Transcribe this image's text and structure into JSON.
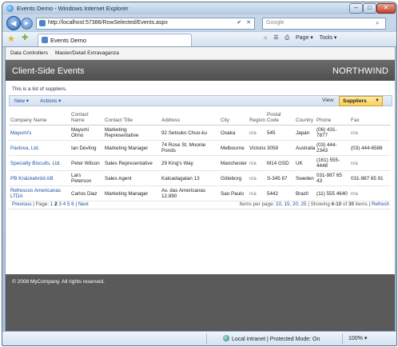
{
  "window": {
    "title": "Events Demo - Windows Internet Explorer"
  },
  "address_bar": {
    "url": "http://localhost:57386/RowSelected/Events.aspx",
    "buttons": "✔ ✕"
  },
  "search": {
    "placeholder": "Google"
  },
  "tab": {
    "label": "Events Demo"
  },
  "command_bar": {
    "home": "⌂",
    "feeds": "☰",
    "print": "⎙",
    "page": "Page ▾",
    "tools": "Tools ▾"
  },
  "menu": {
    "item1": "Data Controllers",
    "item2": "Master/Detail Extravaganza"
  },
  "header": {
    "title": "Client-Side Events",
    "brand": "NORTHWIND"
  },
  "description": "This is a list of suppliers.",
  "toolbar": {
    "new_label": "New ▾",
    "actions_label": "Actions ▾",
    "view_label": "View:",
    "view_value": "Suppliers"
  },
  "table": {
    "headers": {
      "company": "Company Name",
      "contact": "Contact Name",
      "title": "Contact Title",
      "address": "Address",
      "city": "City",
      "region": "Region",
      "postal": "Postal Code",
      "country": "Country",
      "phone": "Phone",
      "fax": "Fax"
    },
    "rows": [
      {
        "company": "Mayumi's",
        "contact": "Mayumi Ohno",
        "title": "Marketing Representative",
        "address": "92 Setsuko Chuo-ku",
        "city": "Osaka",
        "region": "n/a",
        "postal": "545",
        "country": "Japan",
        "phone": "(06) 431-7877",
        "fax": "n/a"
      },
      {
        "company": "Pavlova, Ltd.",
        "contact": "Ian Devling",
        "title": "Marketing Manager",
        "address": "74 Rose St. Moonie Ponds",
        "city": "Melbourne",
        "region": "Victoria",
        "postal": "3058",
        "country": "Australia",
        "phone": "(03) 444-2343",
        "fax": "(03) 444-6588"
      },
      {
        "company": "Specialty Biscuits, Ltd.",
        "contact": "Peter Wilson",
        "title": "Sales Representative",
        "address": "29 King's Way",
        "city": "Manchester",
        "region": "n/a",
        "postal": "M14 GSD",
        "country": "UK",
        "phone": "(161) 555-4448",
        "fax": "n/a"
      },
      {
        "company": "PB Knäckebröd AB",
        "contact": "Lars Peterson",
        "title": "Sales Agent",
        "address": "Kaloadagatan 13",
        "city": "Göteborg",
        "region": "n/a",
        "postal": "S-345 67",
        "country": "Sweden",
        "phone": "031-987 65 43",
        "fax": "031-987 65 91"
      },
      {
        "company": "Refrescos Americanas LTDA",
        "contact": "Carlos Diaz",
        "title": "Marketing Manager",
        "address": "Av. das Americanas 12.890",
        "city": "Sao Paulo",
        "region": "n/a",
        "postal": "5442",
        "country": "Brazil",
        "phone": "(11) 555 4640",
        "fax": "n/a"
      }
    ]
  },
  "pager": {
    "previous": "Previous",
    "page_label": "| Page:",
    "page1": "1",
    "page2": "2",
    "page3": "3",
    "page4": "4",
    "page5": "5",
    "page6": "6",
    "next": "| Next",
    "items_label": "Items per page:",
    "size10": "10",
    "size15": "15",
    "size20": "20",
    "size25": "25",
    "showing_prefix": "| Showing",
    "showing_range": "6-10",
    "showing_of": "of",
    "showing_total": "30",
    "showing_suffix": "items |",
    "refresh": "Refresh"
  },
  "footer": {
    "copyright": "© 2008 MyCompany. All rights reserved."
  },
  "status": {
    "zone": "Local intranet | Protected Mode: On",
    "zoom": "100% ▾"
  }
}
